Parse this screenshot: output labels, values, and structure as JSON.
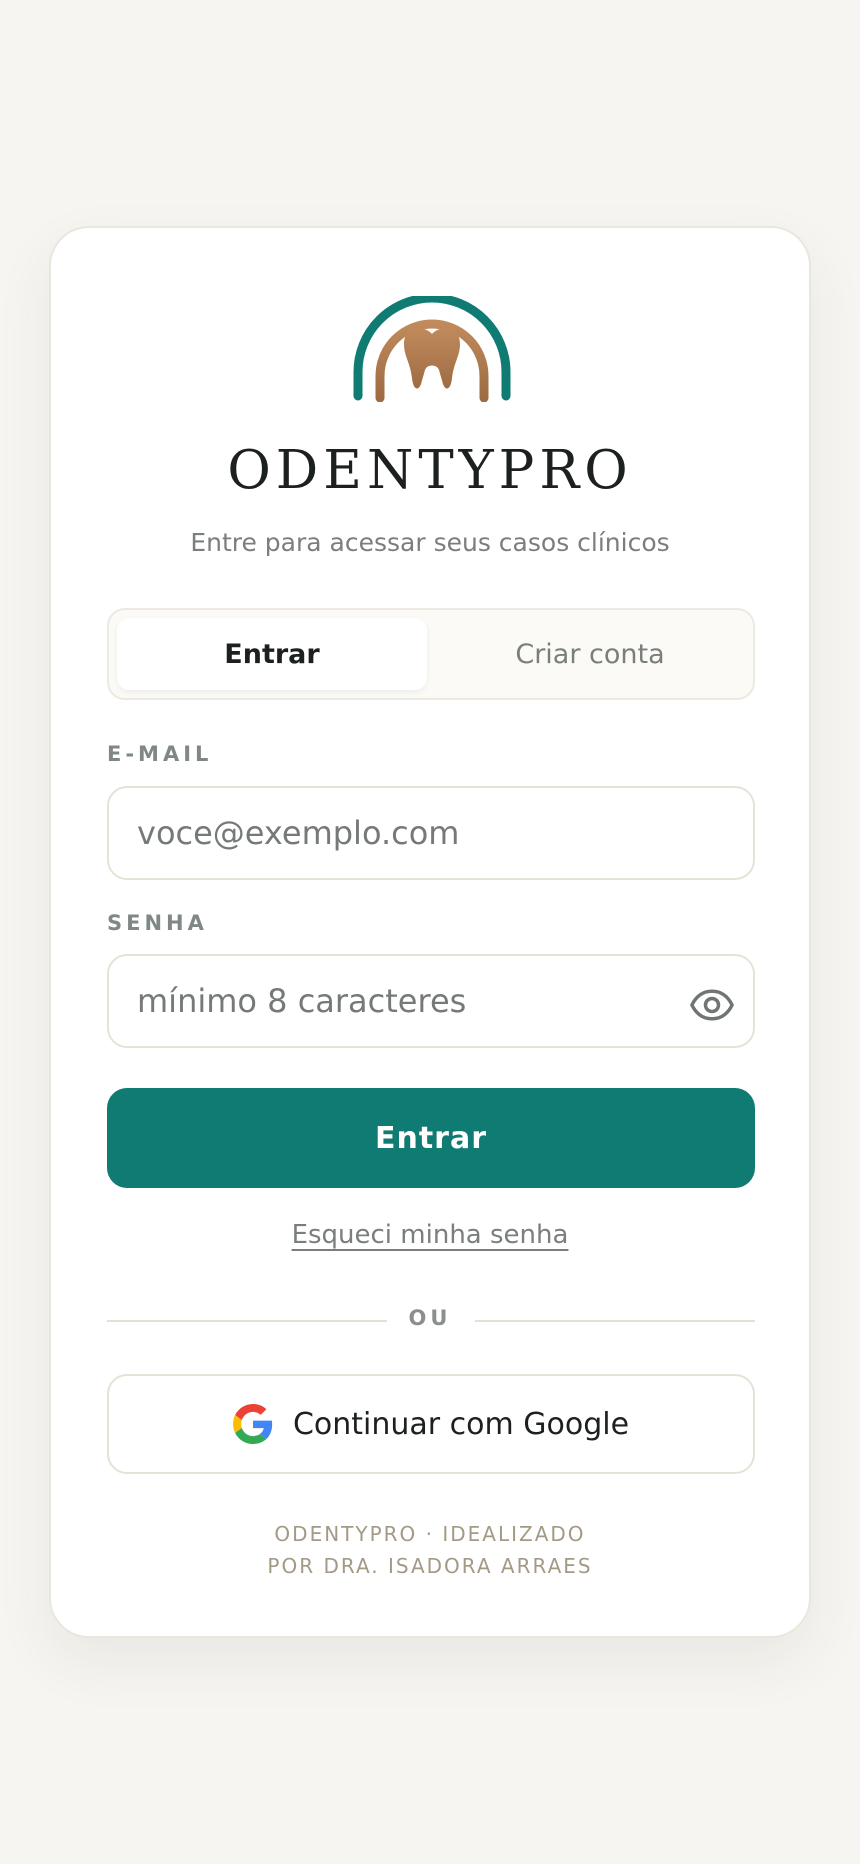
{
  "brand": {
    "name": "ODENTYPRO",
    "subtitle": "Entre para acessar seus casos clínicos"
  },
  "tabs": {
    "login_label": "Entrar",
    "signup_label": "Criar conta",
    "active": "login"
  },
  "form": {
    "email_label": "E-MAIL",
    "email_placeholder": "voce@exemplo.com",
    "email_value": "",
    "password_label": "SENHA",
    "password_placeholder": "mínimo 8 caracteres",
    "password_value": "",
    "password_toggle_icon": "eye-icon",
    "submit_label": "Entrar",
    "forgot_label": "Esqueci minha senha"
  },
  "divider": {
    "label": "OU"
  },
  "google": {
    "label": "Continuar com Google",
    "icon": "google-icon"
  },
  "footer": {
    "line1": "ODENTYPRO · IDEALIZADO",
    "line2": "POR DRA. ISADORA ARRAES"
  },
  "colors": {
    "background": "#f6f5f1",
    "card": "#ffffff",
    "accent_teal": "#0f7b73",
    "accent_copper": "#b07a4e",
    "text_dark": "#1c211f",
    "text_muted": "#7a7f7c",
    "footer_text": "#a39a86"
  }
}
